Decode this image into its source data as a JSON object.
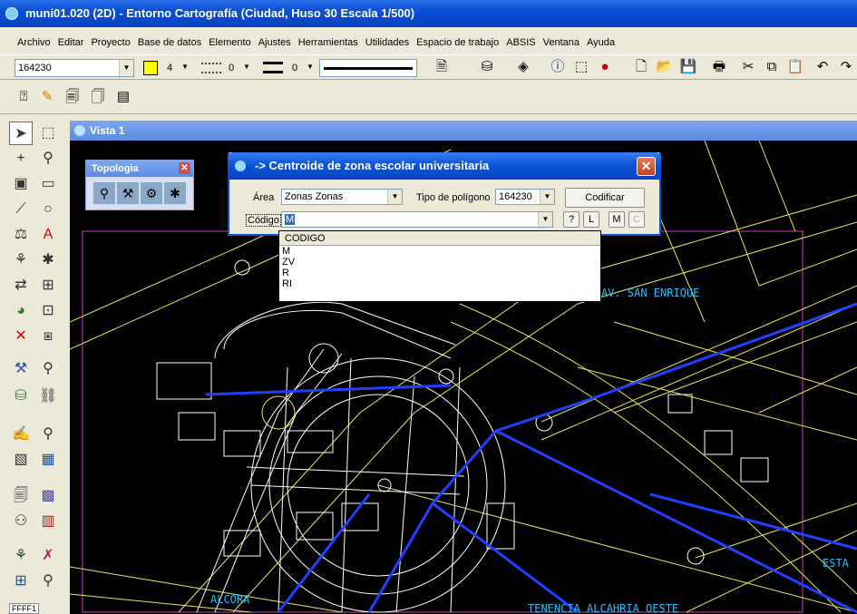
{
  "window": {
    "title": "muni01.020 (2D) - Entorno Cartografía (Ciudad, Huso 30 Escala 1/500)"
  },
  "menu": [
    "Archivo",
    "Editar",
    "Proyecto",
    "Base de datos",
    "Elemento",
    "Ajustes",
    "Herramientas",
    "Utilidades",
    "Espacio de trabajo",
    "ABSIS",
    "Ventana",
    "Ayuda"
  ],
  "toolbar": {
    "level_value": "164230",
    "color_value": "4",
    "style_value": "0",
    "weight_value": "0"
  },
  "view": {
    "title": "Vista 1"
  },
  "topologia": {
    "title": "Topologia"
  },
  "dialog": {
    "title": "-> Centroide de zona escolar universitaria",
    "area_label": "Área",
    "area_value": "Zonas Zonas",
    "tipo_label": "Tipo de polígono",
    "tipo_value": "164230",
    "codificar_label": "Codificar",
    "codigo_label": "Código",
    "codigo_value": "M",
    "btn_help": "?",
    "btn_l": "L",
    "btn_m": "M",
    "btn_c": "C"
  },
  "dropdown": {
    "header": "CODIGO",
    "items": [
      "M",
      "ZV",
      "R",
      "RI"
    ]
  },
  "map_labels": {
    "l1": "AV. SAN ENRIQUE",
    "l2": "ALCORA",
    "l3": "TENENCIA ALCAHRIA OESTE",
    "l4": "ESTA"
  },
  "status": {
    "text": "FFFF1"
  }
}
